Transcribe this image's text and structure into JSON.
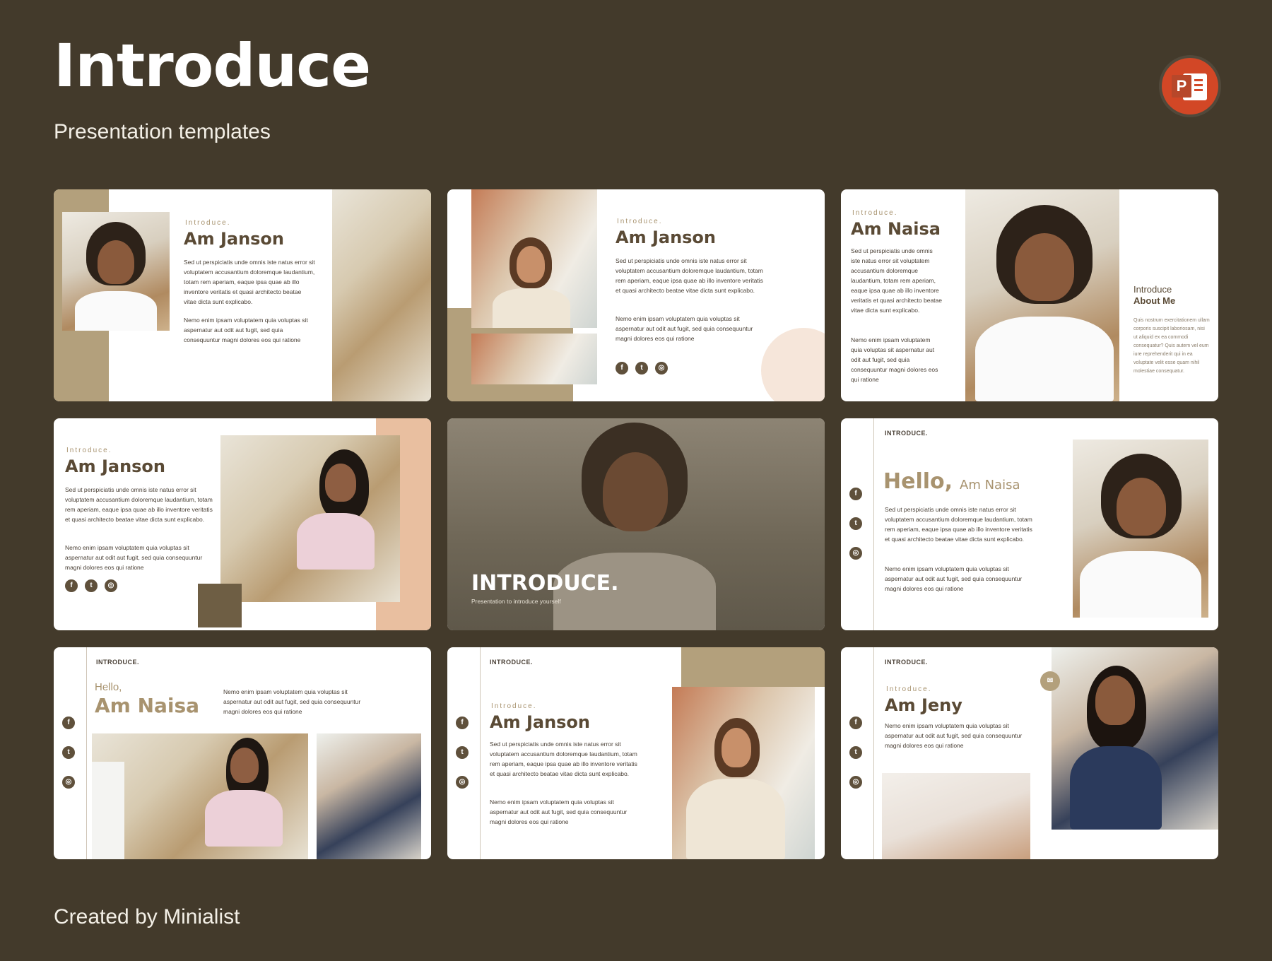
{
  "header": {
    "title": "Introduce",
    "subtitle": "Presentation templates"
  },
  "footer": {
    "credit": "Created by Minialist"
  },
  "colors": {
    "background": "#433a2b",
    "accent": "#a8936f",
    "accent_dark": "#5f503b",
    "peach": "#e9bfa0"
  },
  "icons": {
    "app": "powerpoint-icon",
    "facebook": "f",
    "twitter": "t",
    "instagram": "◎"
  },
  "slides": {
    "s1": {
      "eyebrow": "Introduce.",
      "name": "Am Janson",
      "p1": "Sed ut perspiciatis unde omnis iste natus error sit voluptatem accusantium doloremque laudantium, totam rem aperiam, eaque ipsa quae ab illo inventore veritatis et quasi architecto beatae vitae dicta sunt explicabo.",
      "p2": "Nemo enim ipsam voluptatem quia voluptas sit aspernatur aut odit aut fugit, sed quia consequuntur magni dolores eos qui ratione"
    },
    "s2": {
      "eyebrow": "Introduce.",
      "name": "Am Janson",
      "p1": "Sed ut perspiciatis unde omnis iste natus error sit voluptatem accusantium doloremque laudantium, totam rem aperiam, eaque ipsa quae ab illo inventore veritatis et quasi architecto beatae vitae dicta sunt explicabo.",
      "p2": "Nemo enim ipsam voluptatem quia voluptas sit aspernatur aut odit aut fugit, sed quia consequuntur magni dolores eos qui ratione"
    },
    "s3": {
      "eyebrow": "Introduce.",
      "name": "Am Naisa",
      "p1": "Sed ut perspiciatis unde omnis iste natus error sit voluptatem accusantium doloremque laudantium, totam rem aperiam, eaque ipsa quae ab illo inventore veritatis et quasi architecto beatae vitae dicta sunt explicabo.",
      "p2": "Nemo enim ipsam voluptatem quia voluptas sit aspernatur aut odit aut fugit, sed quia consequuntur magni dolores eos qui ratione",
      "side_title": "Introduce",
      "side_sub": "About Me",
      "side_text": "Quis nostrum exercitationem ullam corporis suscipit laboriosam, nisi ut aliquid ex ea commodi consequatur? Quis autem vel eum iure reprehenderit qui in ea voluptate velit esse quam nihil molestiae consequatur."
    },
    "s4": {
      "eyebrow": "Introduce.",
      "name": "Am Janson",
      "p1": "Sed ut perspiciatis unde omnis iste natus error sit voluptatem accusantium doloremque laudantium, totam rem aperiam, eaque ipsa quae ab illo inventore veritatis et quasi architecto beatae vitae dicta sunt explicabo.",
      "p2": "Nemo enim ipsam voluptatem quia voluptas sit aspernatur aut odit aut fugit, sed quia consequuntur magni dolores eos qui ratione"
    },
    "s5": {
      "title": "INTRODUCE.",
      "subtitle": "Presentation to introduce yourself"
    },
    "s6": {
      "label": "INTRODUCE.",
      "hello": "Hello,",
      "name": "Am Naisa",
      "p1": "Sed ut perspiciatis unde omnis iste natus error sit voluptatem accusantium doloremque laudantium, totam rem aperiam, eaque ipsa quae ab illo inventore veritatis et quasi architecto beatae vitae dicta sunt explicabo.",
      "p2": "Nemo enim ipsam voluptatem quia voluptas sit aspernatur aut odit aut fugit, sed quia consequuntur magni dolores eos qui ratione"
    },
    "s7": {
      "label": "INTRODUCE.",
      "hello": "Hello,",
      "name": "Am Naisa",
      "p1": "Nemo enim ipsam voluptatem quia voluptas sit aspernatur aut odit aut fugit, sed quia consequuntur magni dolores eos qui ratione"
    },
    "s8": {
      "label": "INTRODUCE.",
      "eyebrow": "Introduce.",
      "name": "Am Janson",
      "p1": "Sed ut perspiciatis unde omnis iste natus error sit voluptatem accusantium doloremque laudantium, totam rem aperiam, eaque ipsa quae ab illo inventore veritatis et quasi architecto beatae vitae dicta sunt explicabo.",
      "p2": "Nemo enim ipsam voluptatem quia voluptas sit aspernatur aut odit aut fugit, sed quia consequuntur magni dolores eos qui ratione"
    },
    "s9": {
      "label": "INTRODUCE.",
      "eyebrow": "Introduce.",
      "name": "Am Jeny",
      "p1": "Nemo enim ipsam voluptatem quia voluptas sit aspernatur aut odit aut fugit, sed quia consequuntur magni dolores eos qui ratione"
    }
  }
}
